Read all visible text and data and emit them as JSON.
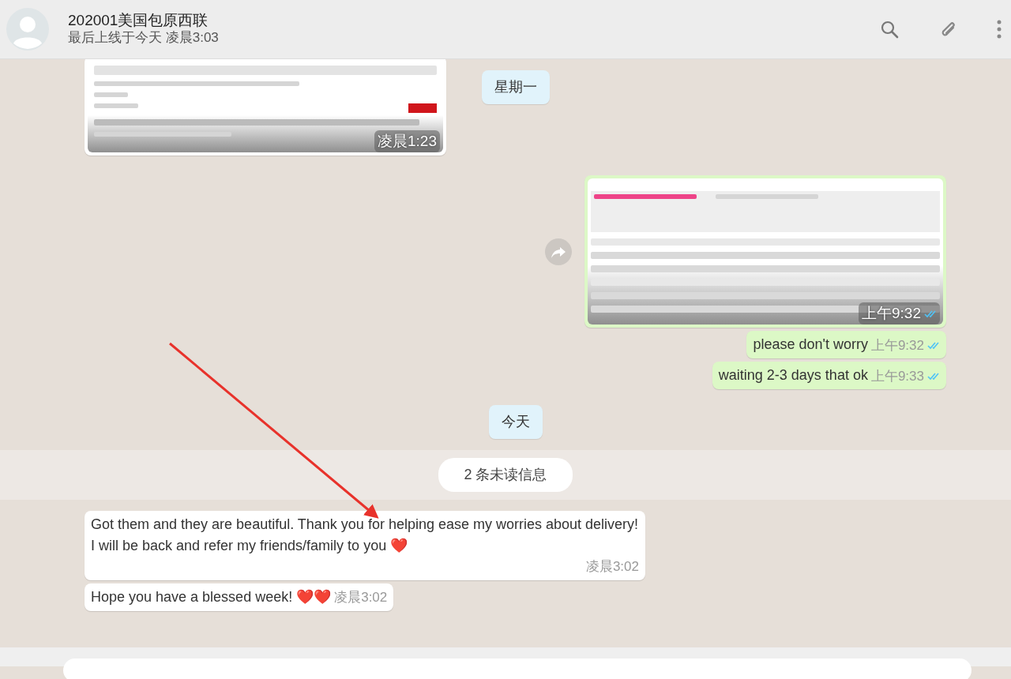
{
  "header": {
    "title": "202001美国包原西联",
    "status": "最后上线于今天 凌晨3:03"
  },
  "messages": [
    {
      "kind": "image",
      "outgoing": false,
      "time": "凌晨1:23"
    },
    {
      "kind": "date",
      "text": "星期一"
    },
    {
      "kind": "image",
      "outgoing": true,
      "time": "上午9:32",
      "read": true,
      "forward_button": true
    },
    {
      "kind": "text",
      "outgoing": true,
      "text": "please don't worry",
      "time": "上午9:32",
      "read": true
    },
    {
      "kind": "text",
      "outgoing": true,
      "text": "waiting 2-3 days  that ok",
      "time": "上午9:33",
      "read": true
    },
    {
      "kind": "date",
      "text": "今天"
    },
    {
      "kind": "unread",
      "text": "2 条未读信息"
    },
    {
      "kind": "text",
      "outgoing": false,
      "text": "Got them and they are beautiful. Thank you for helping ease my worries about delivery! I will be back and refer my friends/family to you ❤️",
      "time": "凌晨3:02"
    },
    {
      "kind": "text",
      "outgoing": false,
      "text": "Hope you have a blessed week! ❤️❤️",
      "time": "凌晨3:02"
    }
  ]
}
